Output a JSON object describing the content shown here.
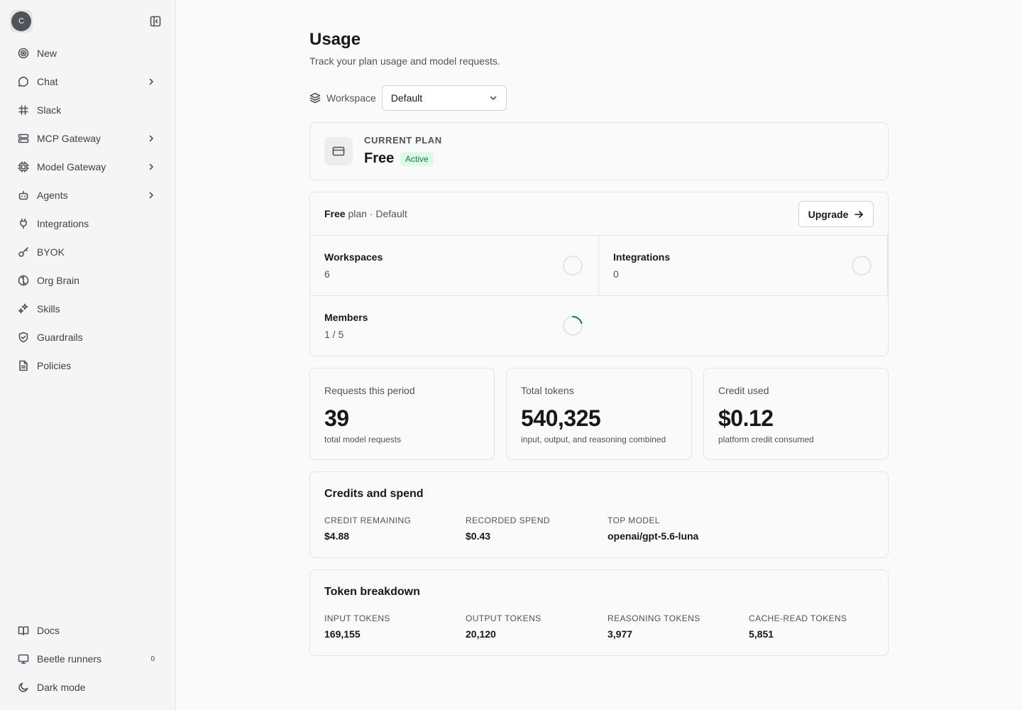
{
  "sidebar": {
    "avatar_initial": "C",
    "items": [
      {
        "label": "New",
        "icon": "target-icon"
      },
      {
        "label": "Chat",
        "icon": "chat-bubble-icon",
        "has_submenu": true
      },
      {
        "label": "Slack",
        "icon": "slack-icon"
      },
      {
        "label": "MCP Gateway",
        "icon": "server-icon",
        "has_submenu": true
      },
      {
        "label": "Model Gateway",
        "icon": "cpu-icon",
        "has_submenu": true
      },
      {
        "label": "Agents",
        "icon": "bot-icon",
        "has_submenu": true
      },
      {
        "label": "Integrations",
        "icon": "plug-icon"
      },
      {
        "label": "BYOK",
        "icon": "key-icon"
      },
      {
        "label": "Org Brain",
        "icon": "brain-icon"
      },
      {
        "label": "Skills",
        "icon": "sparkles-icon"
      },
      {
        "label": "Guardrails",
        "icon": "shield-icon"
      },
      {
        "label": "Policies",
        "icon": "document-icon"
      }
    ],
    "bottom": [
      {
        "label": "Docs",
        "icon": "book-icon"
      },
      {
        "label": "Beetle runners",
        "icon": "monitor-icon",
        "count": "0"
      },
      {
        "label": "Dark mode",
        "icon": "moon-icon"
      }
    ]
  },
  "page": {
    "title": "Usage",
    "subtitle": "Track your plan usage and model requests."
  },
  "workspace": {
    "label": "Workspace",
    "selected": "Default"
  },
  "plan": {
    "caption": "CURRENT PLAN",
    "name": "Free",
    "status": "Active"
  },
  "limits": {
    "plan_name": "Free",
    "plan_suffix": " plan · Default",
    "upgrade_label": "Upgrade",
    "workspaces": {
      "title": "Workspaces",
      "value": "6",
      "usage_fraction": 0
    },
    "integrations": {
      "title": "Integrations",
      "value": "0",
      "usage_fraction": 0
    },
    "members": {
      "title": "Members",
      "value": "1 / 5",
      "usage_fraction": 0.2
    }
  },
  "stats": [
    {
      "label": "Requests this period",
      "value": "39",
      "desc": "total model requests"
    },
    {
      "label": "Total tokens",
      "value": "540,325",
      "desc": "input, output, and reasoning combined"
    },
    {
      "label": "Credit used",
      "value": "$0.12",
      "desc": "platform credit consumed"
    }
  ],
  "credits": {
    "title": "Credits and spend",
    "items": [
      {
        "caption": "CREDIT REMAINING",
        "value": "$4.88"
      },
      {
        "caption": "RECORDED SPEND",
        "value": "$0.43"
      },
      {
        "caption": "TOP MODEL",
        "value": "openai/gpt-5.6-luna"
      }
    ]
  },
  "tokens": {
    "title": "Token breakdown",
    "items": [
      {
        "caption": "INPUT TOKENS",
        "value": "169,155"
      },
      {
        "caption": "OUTPUT TOKENS",
        "value": "20,120"
      },
      {
        "caption": "REASONING TOKENS",
        "value": "3,977"
      },
      {
        "caption": "CACHE-READ TOKENS",
        "value": "5,851"
      }
    ]
  },
  "colors": {
    "accent_green": "#15803d",
    "ring_track": "#e4e4e7",
    "ring_fill": "#15803d"
  }
}
